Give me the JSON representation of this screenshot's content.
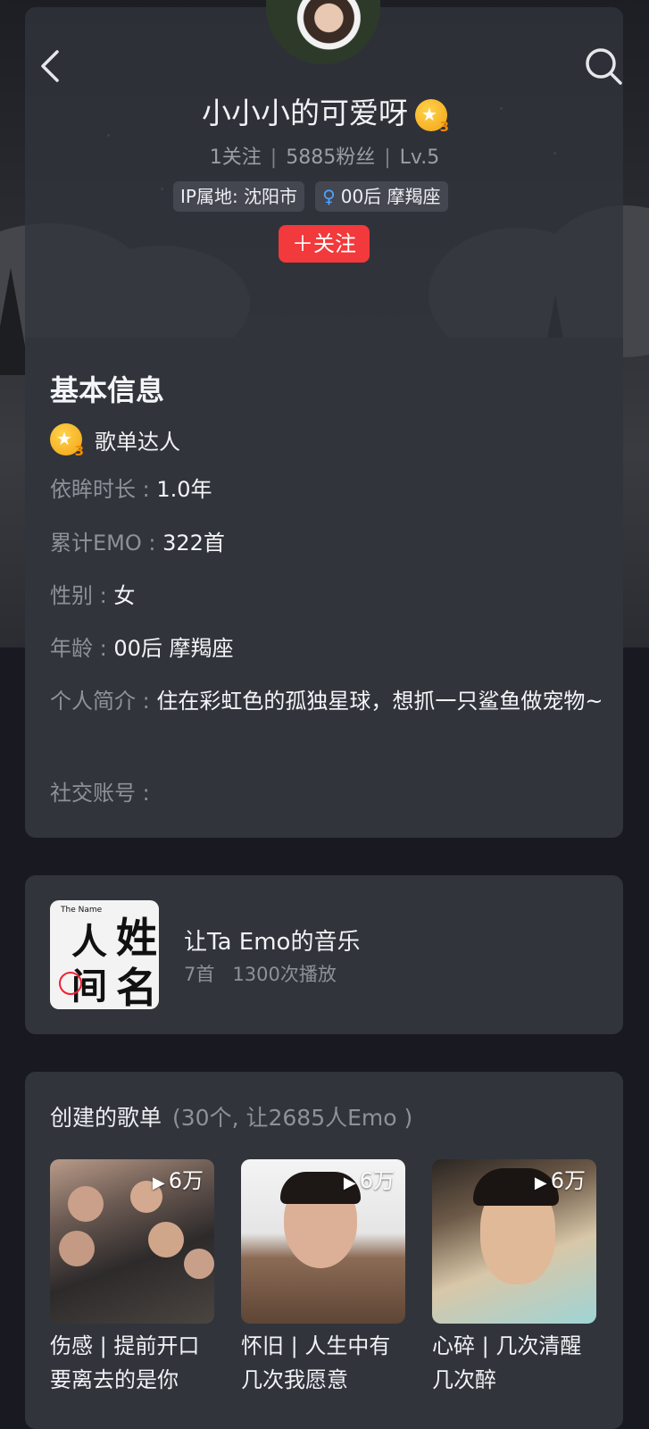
{
  "header": {
    "username": "小小小的可爱呀",
    "badge_level": "3",
    "following": "1关注",
    "fans": "5885粉丝",
    "level": "Lv.5",
    "ip_tag": "IP属地: 沈阳市",
    "gender_symbol": "♀",
    "age_tag": "00后 摩羯座",
    "follow_button": "＋关注",
    "icons": [
      "back-icon",
      "search-icon",
      "avatar",
      "star-badge-icon"
    ]
  },
  "info": {
    "title": "基本信息",
    "badge_label": "歌单达人",
    "rows": [
      {
        "label": "依眸时长 : ",
        "value": "1.0年"
      },
      {
        "label": "累计EMO : ",
        "value": "322首"
      },
      {
        "label": "性别 : ",
        "value": "女"
      },
      {
        "label": "年龄 : ",
        "value": "00后 摩羯座"
      },
      {
        "label": "个人简介 : ",
        "value": "住在彩虹色的孤独星球，想抓一只鲨鱼做宠物~"
      },
      {
        "label": "社交账号 : ",
        "value": ""
      }
    ]
  },
  "emo": {
    "title": "让Ta Emo的音乐",
    "songs": "7首",
    "plays": "1300次播放",
    "cover_text": [
      "人",
      "姓",
      "间",
      "名"
    ],
    "cover_small": "The Name"
  },
  "playlists": {
    "heading": "创建的歌单",
    "count": "(30个, 让2685人Emo )",
    "items": [
      {
        "count": "6万",
        "name": "伤感 | 提前开口要离去的是你"
      },
      {
        "count": "6万",
        "name": "怀旧 | 人生中有几次我愿意"
      },
      {
        "count": "6万",
        "name": "心碎 | 几次清醒几次醉"
      }
    ]
  },
  "colors": {
    "accent_red": "#f2393b",
    "card": "#31343b",
    "background": "#191a21",
    "gender_blue": "#4da3ff",
    "badge_gold": "#f2a313"
  }
}
